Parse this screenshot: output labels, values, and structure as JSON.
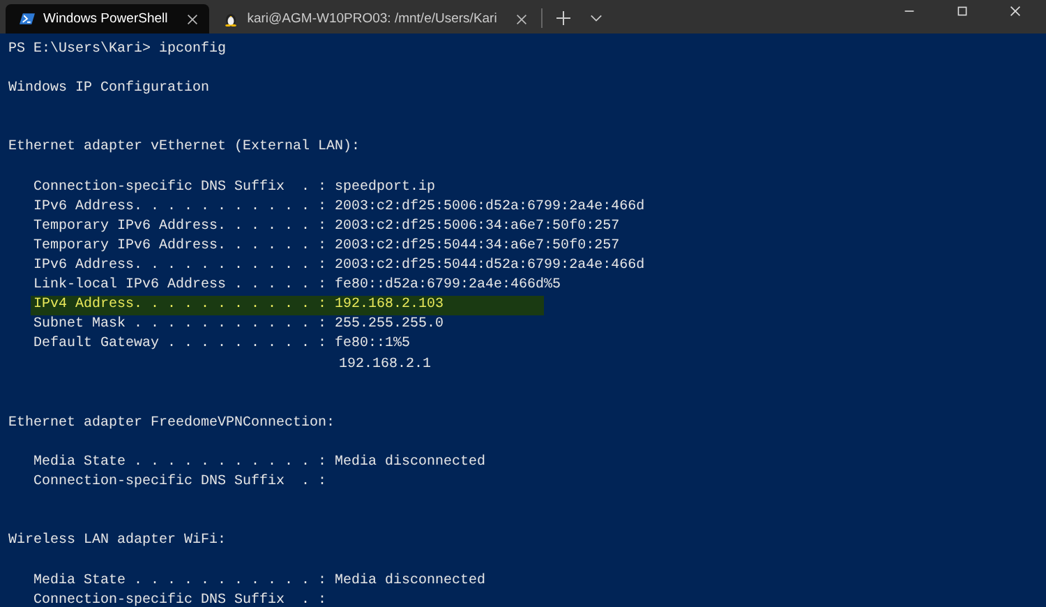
{
  "tabs": [
    {
      "title": "Windows PowerShell",
      "kind": "powershell",
      "selected": true
    },
    {
      "title": "kari@AGM-W10PRO03: /mnt/e/Users/Kari",
      "kind": "linux",
      "selected": false
    }
  ],
  "prompt": {
    "path": "PS E:\\Users\\Kari>",
    "command": "ipconfig"
  },
  "title": "Windows IP Configuration",
  "adapters": [
    {
      "name": "Ethernet adapter vEthernet (External LAN):",
      "entries": [
        {
          "label": "Connection-specific DNS Suffix  . :",
          "values": [
            "speedport.ip"
          ],
          "highlighted": false
        },
        {
          "label": "IPv6 Address. . . . . . . . . . . :",
          "values": [
            "2003:c2:df25:5006:d52a:6799:2a4e:466d"
          ],
          "highlighted": false
        },
        {
          "label": "Temporary IPv6 Address. . . . . . :",
          "values": [
            "2003:c2:df25:5006:34:a6e7:50f0:257"
          ],
          "highlighted": false
        },
        {
          "label": "Temporary IPv6 Address. . . . . . :",
          "values": [
            "2003:c2:df25:5044:34:a6e7:50f0:257"
          ],
          "highlighted": false
        },
        {
          "label": "IPv6 Address. . . . . . . . . . . :",
          "values": [
            "2003:c2:df25:5044:d52a:6799:2a4e:466d"
          ],
          "highlighted": false
        },
        {
          "label": "Link-local IPv6 Address . . . . . :",
          "values": [
            "fe80::d52a:6799:2a4e:466d%5"
          ],
          "highlighted": false
        },
        {
          "label": "IPv4 Address. . . . . . . . . . . :",
          "values": [
            "192.168.2.103"
          ],
          "highlighted": true
        },
        {
          "label": "Subnet Mask . . . . . . . . . . . :",
          "values": [
            "255.255.255.0"
          ],
          "highlighted": false
        },
        {
          "label": "Default Gateway . . . . . . . . . :",
          "values": [
            "fe80::1%5",
            "192.168.2.1"
          ],
          "highlighted": false
        }
      ]
    },
    {
      "name": "Ethernet adapter FreedomeVPNConnection:",
      "entries": [
        {
          "label": "Media State . . . . . . . . . . . :",
          "values": [
            "Media disconnected"
          ],
          "highlighted": false
        },
        {
          "label": "Connection-specific DNS Suffix  . :",
          "highlighted": false
        }
      ]
    },
    {
      "name": "Wireless LAN adapter WiFi:",
      "entries": [
        {
          "label": "Media State . . . . . . . . . . . :",
          "values": [
            "Media disconnected"
          ],
          "highlighted": false
        },
        {
          "label": "Connection-specific DNS Suffix  . :",
          "highlighted": false
        }
      ]
    }
  ]
}
